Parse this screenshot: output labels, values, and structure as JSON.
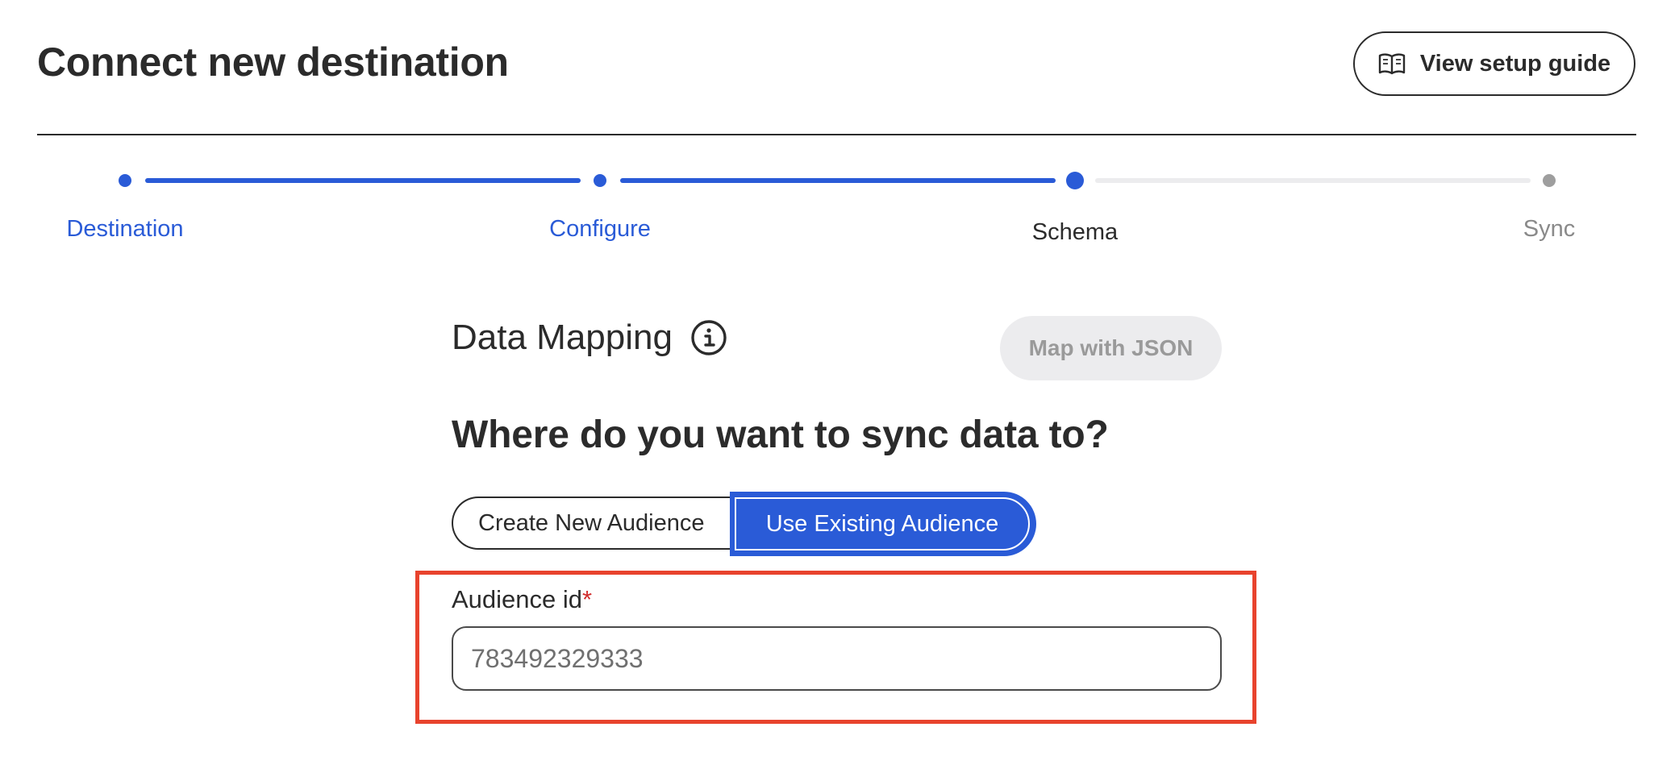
{
  "header": {
    "title": "Connect new destination",
    "guide_button_label": "View setup guide"
  },
  "stepper": {
    "steps": [
      {
        "label": "Destination",
        "state": "completed"
      },
      {
        "label": "Configure",
        "state": "completed"
      },
      {
        "label": "Schema",
        "state": "current"
      },
      {
        "label": "Sync",
        "state": "upcoming"
      }
    ],
    "colors": {
      "active": "#2a5bd7",
      "inactive": "#ececee",
      "inactive_dot": "#9e9e9e",
      "current_label": "#2b2b2b",
      "upcoming_label": "#8a8a8a"
    }
  },
  "mapping": {
    "title": "Data Mapping",
    "json_button_label": "Map with JSON"
  },
  "sync_target": {
    "question": "Where do you want to sync data to?",
    "options": [
      "Create New Audience",
      "Use Existing Audience"
    ],
    "selected": "Use Existing Audience"
  },
  "audience_field": {
    "label": "Audience id",
    "required_marker": "*",
    "placeholder": "783492329333",
    "value": ""
  },
  "colors": {
    "accent": "#2a5bd7",
    "highlight": "#e8432d",
    "text": "#2b2b2b"
  }
}
